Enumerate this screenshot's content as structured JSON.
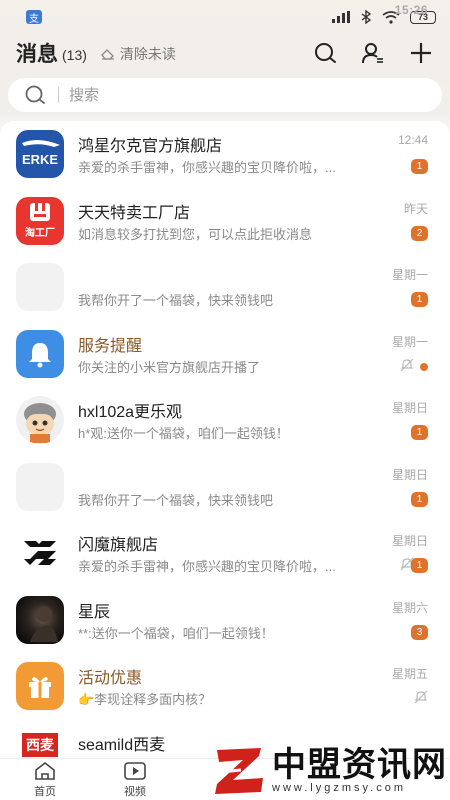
{
  "status_bar": {
    "time": "15:26",
    "notification": "支",
    "battery": "73"
  },
  "header": {
    "title": "消息",
    "count": "(13)",
    "clear_unread": "清除未读"
  },
  "search": {
    "placeholder": "搜索"
  },
  "conversations": [
    {
      "name": "鸿星尔克官方旗舰店",
      "preview": "亲爱的杀手雷神，你感兴趣的宝贝降价啦，...",
      "time": "12:44",
      "badge": "1",
      "avatar_text": "ERKE",
      "highlight": false
    },
    {
      "name": "天天特卖工厂店",
      "preview": "如消息较多打扰到您，可以点此拒收消息",
      "time": "昨天",
      "badge": "2",
      "avatar_text": "淘工厂",
      "highlight": false
    },
    {
      "name": "",
      "preview": "我帮你开了一个福袋，快来领钱吧",
      "time": "星期一",
      "badge": "1",
      "avatar_text": "",
      "highlight": false
    },
    {
      "name": "服务提醒",
      "preview": "你关注的小米官方旗舰店开播了",
      "time": "星期一",
      "badge": "",
      "avatar_text": "",
      "highlight": true,
      "muted": true,
      "dot": true
    },
    {
      "name": "hxl102a更乐观",
      "preview": "h*观:送你一个福袋，咱们一起领钱！",
      "time": "星期日",
      "badge": "1",
      "avatar_text": "",
      "highlight": false
    },
    {
      "name": "",
      "preview": "我帮你开了一个福袋，快来领钱吧",
      "time": "星期日",
      "badge": "1",
      "avatar_text": "",
      "highlight": false
    },
    {
      "name": "闪魔旗舰店",
      "preview": "亲爱的杀手雷神，你感兴趣的宝贝降价啦，...",
      "time": "星期日",
      "badge": "1",
      "avatar_text": "",
      "highlight": false,
      "muted": true
    },
    {
      "name": "星辰",
      "preview": "**:送你一个福袋，咱们一起领钱！",
      "time": "星期六",
      "badge": "3",
      "avatar_text": "",
      "highlight": false
    },
    {
      "name": "活动优惠",
      "preview": "👉李现诠释多面内核？",
      "time": "星期五",
      "badge": "",
      "avatar_text": "",
      "highlight": true,
      "muted": true
    },
    {
      "name": "seamild西麦",
      "preview": "",
      "time": "",
      "badge": "",
      "avatar_text": "西麦",
      "highlight": false
    }
  ],
  "tabbar": [
    {
      "label": "首页",
      "icon": "home-icon"
    },
    {
      "label": "视频",
      "icon": "video-icon"
    }
  ],
  "watermark": {
    "main": "中盟资讯网",
    "sub": "www.lygzmsy.com"
  },
  "colors": {
    "accent": "#e0732c",
    "highlight_name": "#8a5a2b",
    "background": "#f6f6f6"
  }
}
